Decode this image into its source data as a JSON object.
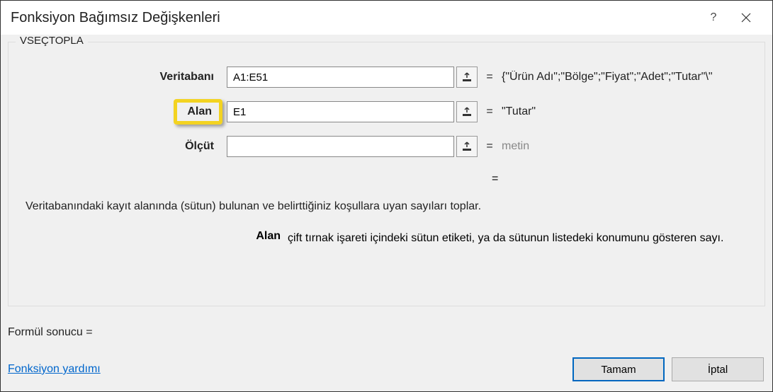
{
  "window": {
    "title": "Fonksiyon Bağımsız Değişkenleri",
    "help": "?",
    "close": "×"
  },
  "group": {
    "title": "VSEÇTOPLA",
    "fields": [
      {
        "label": "Veritabanı",
        "value": "A1:E51",
        "result": "{\"Ürün Adı\";\"Bölge\";\"Fiyat\";\"Adet\";\"Tutar\"\\\"",
        "highlighted": false,
        "placeholder": false
      },
      {
        "label": "Alan",
        "value": "E1",
        "result": "\"Tutar\"",
        "highlighted": true,
        "placeholder": false
      },
      {
        "label": "Ölçüt",
        "value": "",
        "result": "metin",
        "highlighted": false,
        "placeholder": true
      }
    ],
    "resultEquals": "="
  },
  "description": "Veritabanındaki kayıt alanında (sütun) bulunan ve belirttiğiniz koşullara uyan sayıları toplar.",
  "paramDesc": {
    "label": "Alan",
    "text": "çift tırnak işareti içindeki sütun etiketi, ya da sütunun listedeki konumunu gösteren sayı."
  },
  "formulaResult": "Formül sonucu =",
  "helpLink": "Fonksiyon yardımı",
  "buttons": {
    "ok": "Tamam",
    "cancel": "İptal"
  }
}
